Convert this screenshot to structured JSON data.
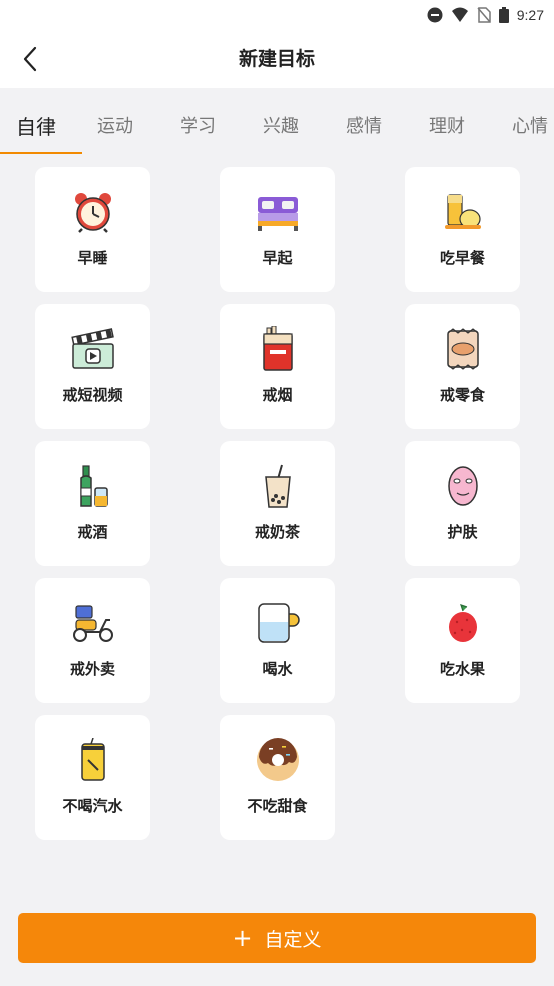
{
  "status_bar": {
    "time": "9:27"
  },
  "header": {
    "title": "新建目标",
    "back_icon": "chevron-left-icon"
  },
  "tabs": [
    {
      "label": "自律",
      "active": true
    },
    {
      "label": "运动",
      "active": false
    },
    {
      "label": "学习",
      "active": false
    },
    {
      "label": "兴趣",
      "active": false
    },
    {
      "label": "感情",
      "active": false
    },
    {
      "label": "理财",
      "active": false
    },
    {
      "label": "心情",
      "active": false
    }
  ],
  "goals": [
    {
      "label": "早睡",
      "icon": "alarm-clock-icon"
    },
    {
      "label": "早起",
      "icon": "bed-icon"
    },
    {
      "label": "吃早餐",
      "icon": "breakfast-icon"
    },
    {
      "label": "戒短视频",
      "icon": "video-clapper-icon"
    },
    {
      "label": "戒烟",
      "icon": "cigarette-pack-icon"
    },
    {
      "label": "戒零食",
      "icon": "snack-bag-icon"
    },
    {
      "label": "戒酒",
      "icon": "wine-bottle-icon"
    },
    {
      "label": "戒奶茶",
      "icon": "bubble-tea-icon"
    },
    {
      "label": "护肤",
      "icon": "face-mask-icon"
    },
    {
      "label": "戒外卖",
      "icon": "delivery-scooter-icon"
    },
    {
      "label": "喝水",
      "icon": "water-cup-icon"
    },
    {
      "label": "吃水果",
      "icon": "lychee-icon"
    },
    {
      "label": "不喝汽水",
      "icon": "soda-can-icon"
    },
    {
      "label": "不吃甜食",
      "icon": "donut-icon"
    }
  ],
  "custom_button": {
    "plus": "+",
    "label": "自定义"
  },
  "colors": {
    "accent": "#f5870a",
    "background": "#f2f2f4",
    "card": "#ffffff"
  }
}
